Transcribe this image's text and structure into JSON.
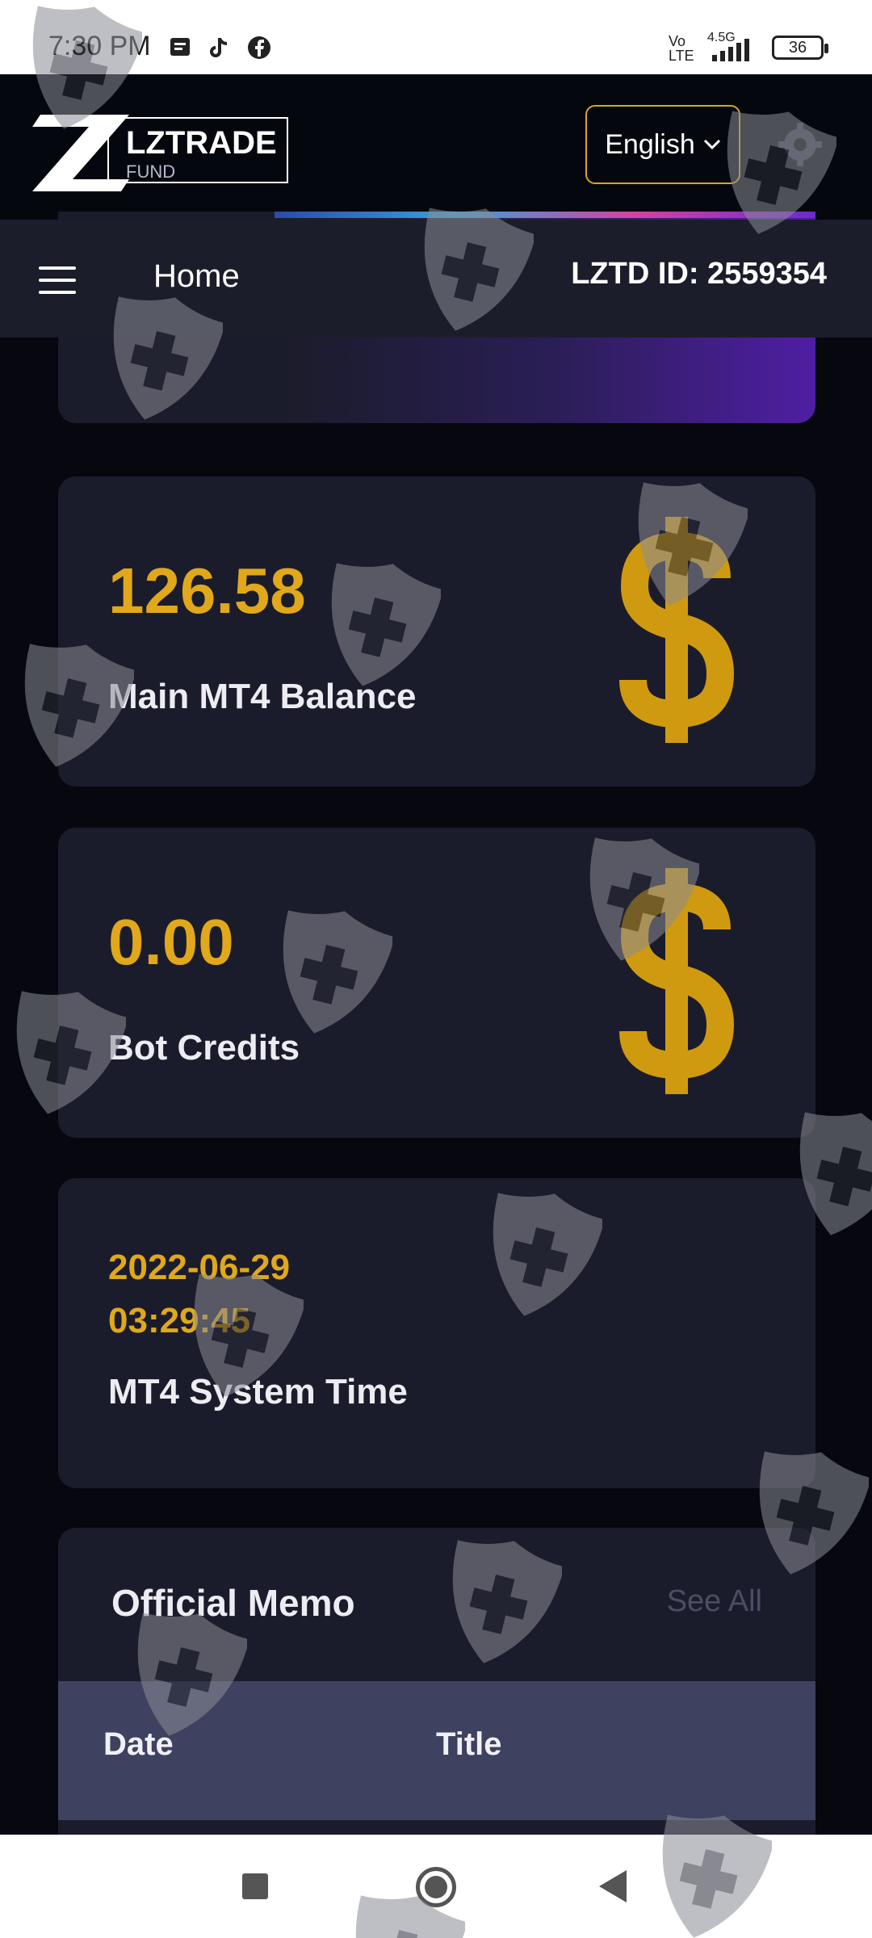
{
  "status_bar": {
    "time": "7:30 PM",
    "network": "4.5G",
    "volte": "Vo LTE",
    "battery": "36",
    "icons": [
      "message-icon",
      "tiktok-icon",
      "facebook-icon"
    ]
  },
  "header": {
    "logo_text": "LZTRADE",
    "logo_sub": "FUND",
    "language": "English",
    "settings_icon": "gear-icon"
  },
  "navbar": {
    "title": "Home",
    "user_id": "LZTD ID: 2559354"
  },
  "cards": [
    {
      "value": "126.58",
      "label": "Main MT4 Balance",
      "icon": "dollar-icon"
    },
    {
      "value": "0.00",
      "label": "Bot Credits",
      "icon": "dollar-icon"
    },
    {
      "date": "2022-06-29",
      "time": "03:29:45",
      "label": "MT4 System Time"
    }
  ],
  "memo": {
    "title": "Official Memo",
    "see_all": "See All",
    "columns": [
      "Date",
      "Title"
    ]
  },
  "colors": {
    "accent": "#e0a81a",
    "card_bg": "#1b1c2b",
    "page_bg": "#06070f",
    "table_header": "#3f4160"
  }
}
